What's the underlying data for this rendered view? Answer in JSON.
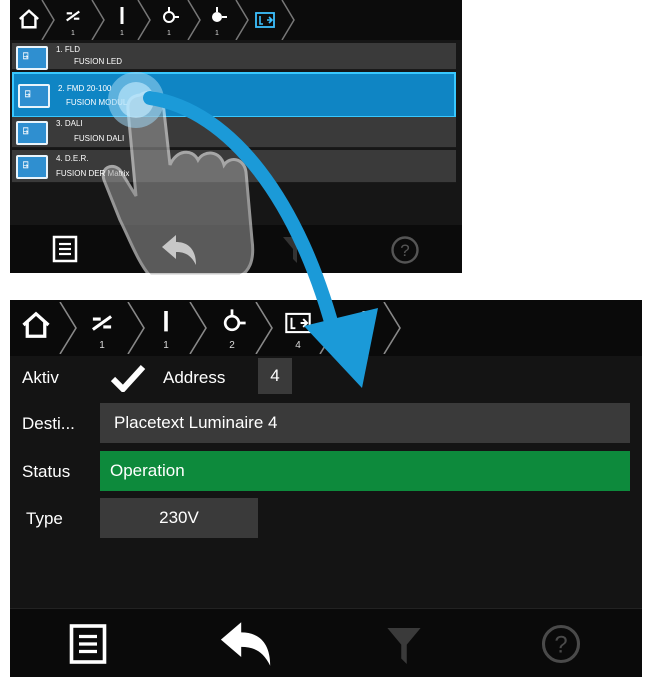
{
  "top_screen": {
    "breadcrumb": [
      {
        "icon": "home-icon",
        "num": ""
      },
      {
        "icon": "disconnect-icon",
        "num": "1"
      },
      {
        "icon": "line-icon",
        "num": "1"
      },
      {
        "icon": "luminaire-icon",
        "num": "1"
      },
      {
        "icon": "bulb-icon",
        "num": "1"
      },
      {
        "icon": "exit-sign-icon",
        "num": ""
      }
    ],
    "rows": [
      {
        "line1": "1. FLD",
        "line2": "FUSION LED"
      },
      {
        "line1": "2. FMD 20-100",
        "line2": "FUSION MODUL"
      },
      {
        "line1": "3. DALI",
        "line2": "FUSION DALI"
      },
      {
        "line1": "4. D.E.R.",
        "line2": "FUSION DER Matrix"
      }
    ],
    "toolbar": [
      "list-icon",
      "back-arrow-icon",
      "filter-icon",
      "help-icon"
    ]
  },
  "bottom_screen": {
    "breadcrumb": [
      {
        "icon": "home-icon",
        "num": ""
      },
      {
        "icon": "disconnect-icon",
        "num": "1"
      },
      {
        "icon": "line-icon",
        "num": "1"
      },
      {
        "icon": "luminaire-icon",
        "num": "2"
      },
      {
        "icon": "exit-sign-icon",
        "num": "4"
      },
      {
        "icon": "info-icon",
        "num": ""
      }
    ],
    "aktiv_label": "Aktiv",
    "address_label": "Address",
    "address_value": "4",
    "destination_label": "Desti...",
    "destination_value": "Placetext Luminaire 4",
    "status_label": "Status",
    "status_value": "Operation",
    "type_label": "Type",
    "type_value": "230V",
    "toolbar": [
      "list-icon",
      "back-arrow-icon",
      "filter-icon",
      "help-icon"
    ]
  },
  "colors": {
    "accent_blue": "#1b9ad8",
    "status_green": "#0d8a3c",
    "field_gray": "#3a3a3a",
    "background": "#141414"
  }
}
